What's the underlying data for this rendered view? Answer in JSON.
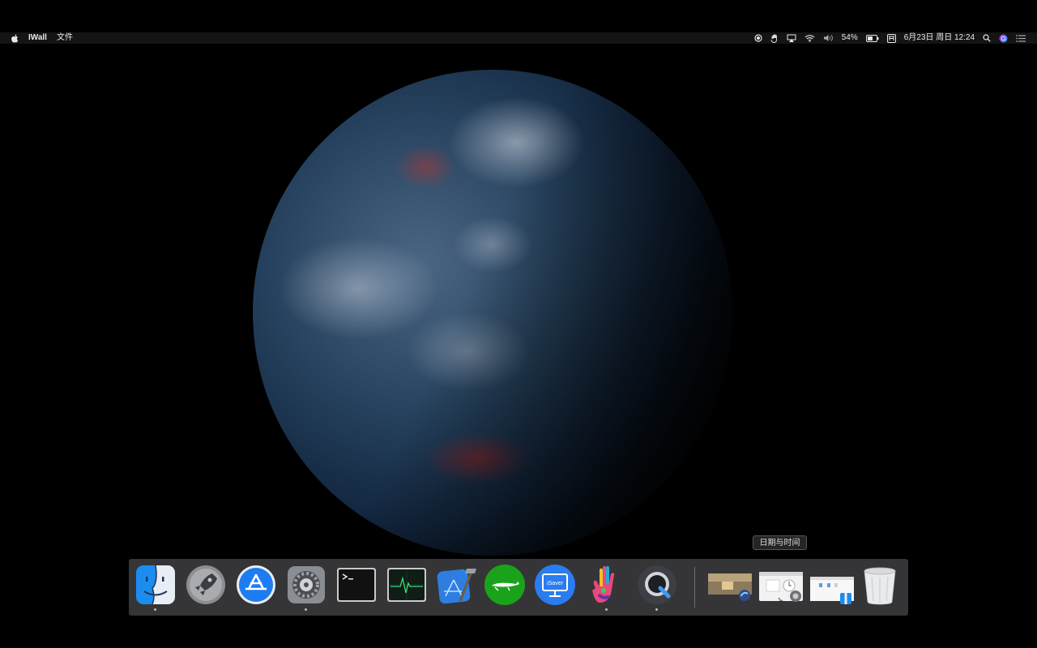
{
  "menubar": {
    "app_name": "IWall",
    "menu_file": "文件",
    "battery_percent": "54%",
    "datetime": "6月23日 周日 12:24"
  },
  "tooltip": {
    "text": "日期与时间"
  },
  "dock": {
    "apps": [
      {
        "name": "Finder",
        "running": true
      },
      {
        "name": "Launchpad",
        "running": false
      },
      {
        "name": "App Store",
        "running": false
      },
      {
        "name": "System Preferences",
        "running": true
      },
      {
        "name": "Terminal",
        "running": false
      },
      {
        "name": "Activity Monitor",
        "running": false
      },
      {
        "name": "Xcode",
        "running": false
      },
      {
        "name": "Green App",
        "running": false
      },
      {
        "name": "iSaver",
        "running": false
      },
      {
        "name": "Handprint App",
        "running": true
      },
      {
        "name": "QuickTime Player",
        "running": true
      }
    ],
    "isaver_label": "iSaver"
  },
  "colors": {
    "menubar_bg": "#141414",
    "dock_bg": "#3a3a3c",
    "appstore_blue": "#1e7cf2",
    "green_app": "#1aa31a"
  }
}
